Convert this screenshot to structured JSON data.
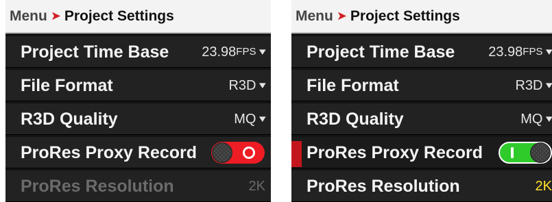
{
  "panels": [
    {
      "breadcrumb": {
        "root": "Menu",
        "arrow": "➤",
        "title": "Project Settings"
      },
      "rows": [
        {
          "label": "Project Time Base",
          "value": "23.98",
          "unit": "FPS",
          "chevron": "▾"
        },
        {
          "label": "File Format",
          "value": "R3D",
          "chevron": "▾"
        },
        {
          "label": "R3D Quality",
          "value": "MQ",
          "chevron": "▾"
        },
        {
          "label": "ProRes Proxy Record",
          "toggle_state": "off",
          "toggle_color": "#ee1c24"
        },
        {
          "label": "ProRes Resolution",
          "value": "2K",
          "state": "disabled"
        }
      ]
    },
    {
      "breadcrumb": {
        "root": "Menu",
        "arrow": "➤",
        "title": "Project Settings"
      },
      "rows": [
        {
          "label": "Project Time Base",
          "value": "23.98",
          "unit": "FPS",
          "chevron": "▾"
        },
        {
          "label": "File Format",
          "value": "R3D",
          "chevron": "▾"
        },
        {
          "label": "R3D Quality",
          "value": "MQ",
          "chevron": "▾"
        },
        {
          "label": "ProRes Proxy Record",
          "toggle_state": "on",
          "toggle_color": "#2fcb2b",
          "selected": true,
          "selection_color": "#c3161c"
        },
        {
          "label": "ProRes Resolution",
          "value": "2K",
          "value_color": "#ffe02a"
        }
      ]
    }
  ]
}
